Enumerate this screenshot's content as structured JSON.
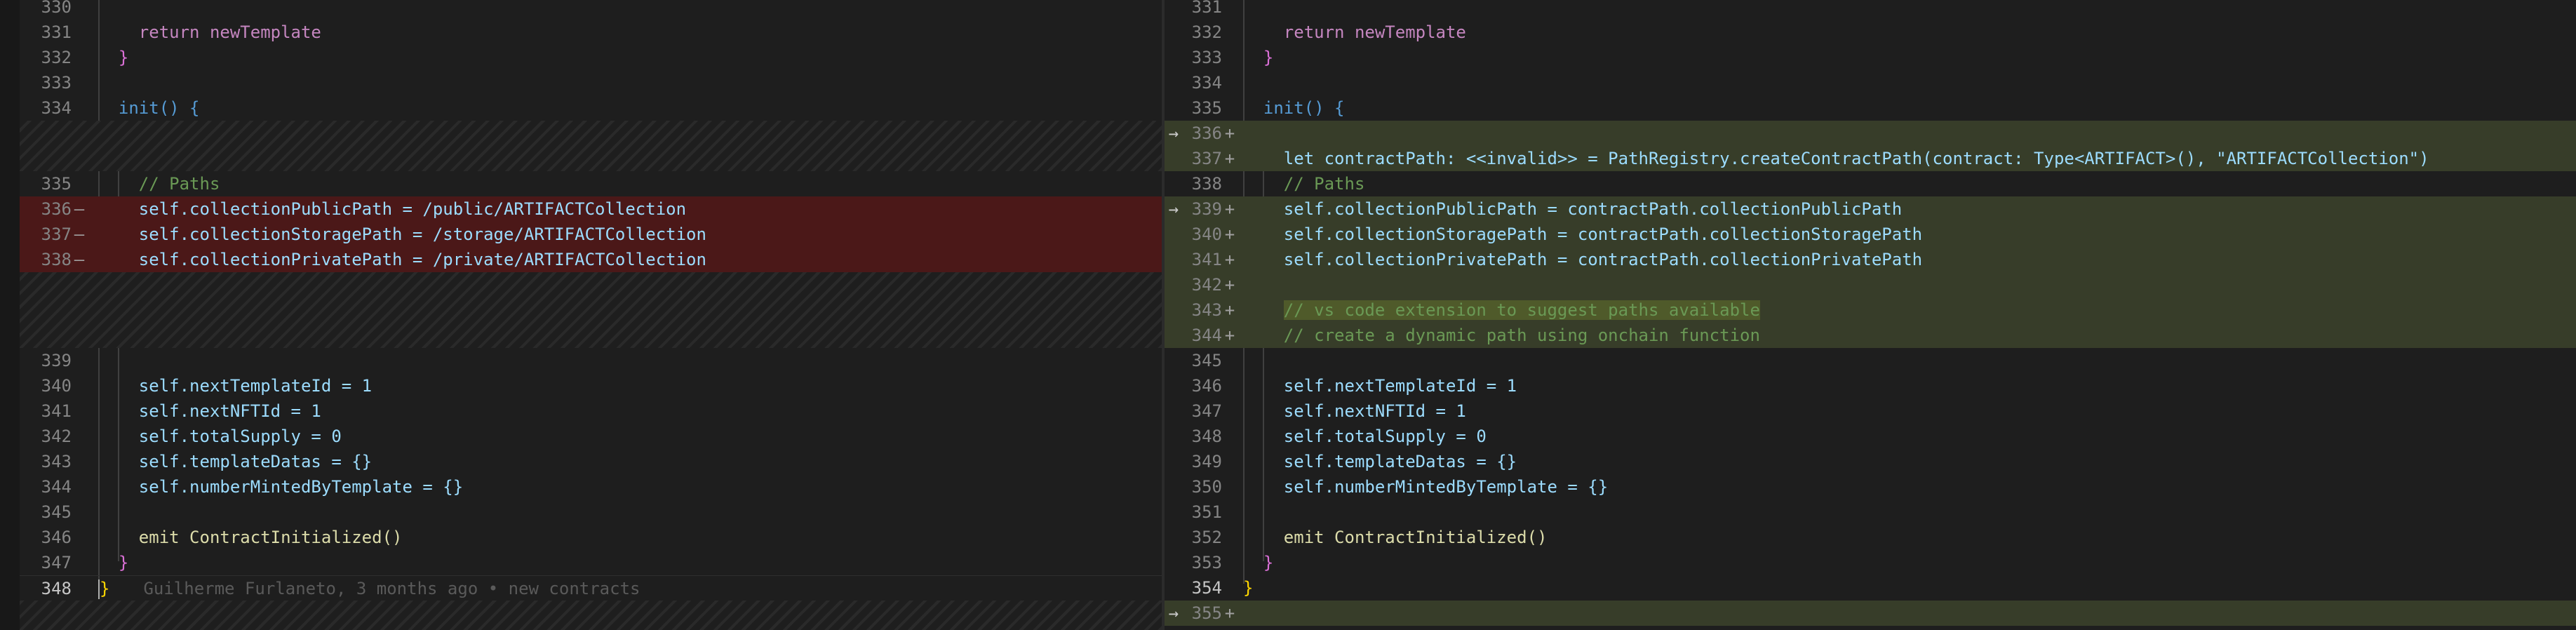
{
  "left": {
    "top_partial_line": "330",
    "lines": [
      {
        "n": "331",
        "mark": "",
        "code": "return newTemplate"
      },
      {
        "n": "332",
        "mark": "",
        "code": "}"
      },
      {
        "n": "333",
        "mark": "",
        "code": ""
      },
      {
        "n": "334",
        "mark": "",
        "code": "init() {"
      },
      {
        "n": "335",
        "mark": "",
        "code": "// Paths"
      },
      {
        "n": "336",
        "mark": "—",
        "code": "self.collectionPublicPath = /public/ARTIFACTCollection"
      },
      {
        "n": "337",
        "mark": "—",
        "code": "self.collectionStoragePath = /storage/ARTIFACTCollection"
      },
      {
        "n": "338",
        "mark": "—",
        "code": "self.collectionPrivatePath = /private/ARTIFACTCollection"
      },
      {
        "n": "339",
        "mark": "",
        "code": ""
      },
      {
        "n": "340",
        "mark": "",
        "code": "self.nextTemplateId = 1"
      },
      {
        "n": "341",
        "mark": "",
        "code": "self.nextNFTId = 1"
      },
      {
        "n": "342",
        "mark": "",
        "code": "self.totalSupply = 0"
      },
      {
        "n": "343",
        "mark": "",
        "code": "self.templateDatas = {}"
      },
      {
        "n": "344",
        "mark": "",
        "code": "self.numberMintedByTemplate = {}"
      },
      {
        "n": "345",
        "mark": "",
        "code": ""
      },
      {
        "n": "346",
        "mark": "",
        "code": "emit ContractInitialized()"
      },
      {
        "n": "347",
        "mark": "",
        "code": "}"
      },
      {
        "n": "348",
        "mark": "",
        "code": "}"
      }
    ],
    "blame": "Guilherme Furlaneto, 3 months ago • new contracts"
  },
  "right": {
    "top_partial_line": "331",
    "lines": [
      {
        "n": "332",
        "mark": "",
        "code": "return newTemplate"
      },
      {
        "n": "333",
        "mark": "",
        "code": "}"
      },
      {
        "n": "334",
        "mark": "",
        "code": ""
      },
      {
        "n": "335",
        "mark": "",
        "code": "init() {"
      },
      {
        "n": "336",
        "mark": "+",
        "code": ""
      },
      {
        "n": "337",
        "mark": "+",
        "code": "let contractPath: <<invalid>> = PathRegistry.createContractPath(contract: Type<ARTIFACT>(), \"ARTIFACTCollection\")"
      },
      {
        "n": "338",
        "mark": "",
        "code": "// Paths"
      },
      {
        "n": "339",
        "mark": "+",
        "code": "self.collectionPublicPath = contractPath.collectionPublicPath"
      },
      {
        "n": "340",
        "mark": "+",
        "code": "self.collectionStoragePath = contractPath.collectionStoragePath"
      },
      {
        "n": "341",
        "mark": "+",
        "code": "self.collectionPrivatePath = contractPath.collectionPrivatePath"
      },
      {
        "n": "342",
        "mark": "+",
        "code": ""
      },
      {
        "n": "343",
        "mark": "+",
        "code": "// vs code extension to suggest paths available"
      },
      {
        "n": "344",
        "mark": "+",
        "code": "// create a dynamic path using onchain function"
      },
      {
        "n": "345",
        "mark": "",
        "code": ""
      },
      {
        "n": "346",
        "mark": "",
        "code": "self.nextTemplateId = 1"
      },
      {
        "n": "347",
        "mark": "",
        "code": "self.nextNFTId = 1"
      },
      {
        "n": "348",
        "mark": "",
        "code": "self.totalSupply = 0"
      },
      {
        "n": "349",
        "mark": "",
        "code": "self.templateDatas = {}"
      },
      {
        "n": "350",
        "mark": "",
        "code": "self.numberMintedByTemplate = {}"
      },
      {
        "n": "351",
        "mark": "",
        "code": ""
      },
      {
        "n": "352",
        "mark": "",
        "code": "emit ContractInitialized()"
      },
      {
        "n": "353",
        "mark": "",
        "code": "}"
      },
      {
        "n": "354",
        "mark": "",
        "code": "}"
      },
      {
        "n": "355",
        "mark": "+",
        "code": ""
      }
    ]
  },
  "colors": {
    "background": "#1e1e1e",
    "removed_line": "#4b1818",
    "added_line": "#373d29",
    "keyword_purple": "#c586c0",
    "keyword_blue": "#569cd6",
    "function_yellow": "#dcdcaa",
    "comment_green": "#6a9955",
    "string_orange": "#ce9178"
  },
  "icons": {
    "diff_arrow": "arrow-right-icon"
  }
}
